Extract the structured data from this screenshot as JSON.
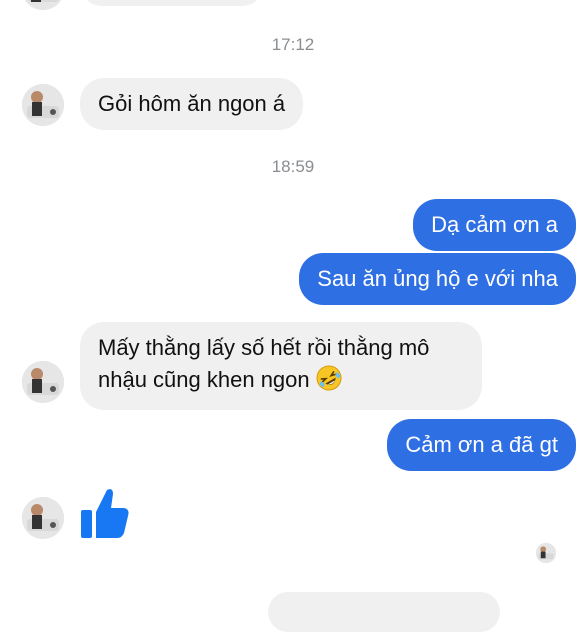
{
  "timestamps": {
    "t1": "17:12",
    "t2": "18:59"
  },
  "messages": {
    "m1": "Gỏi hôm ăn ngon á",
    "m2": "Dạ cảm ơn a",
    "m3": "Sau ăn ủng hộ e với nha",
    "m4_line1": "Mấy thằng lấy số hết rồi thằng mô",
    "m4_line2": "nhậu cũng khen ngon",
    "m5": "Cảm ơn a đã gt"
  },
  "icons": {
    "laughing": "rolling-on-floor-laughing-emoji",
    "like": "thumbs-up-icon",
    "avatar": "contact-avatar"
  },
  "colors": {
    "outgoing": "#2f6fe4",
    "incoming": "#f0f0f0",
    "timestamp": "#8a8d91"
  }
}
